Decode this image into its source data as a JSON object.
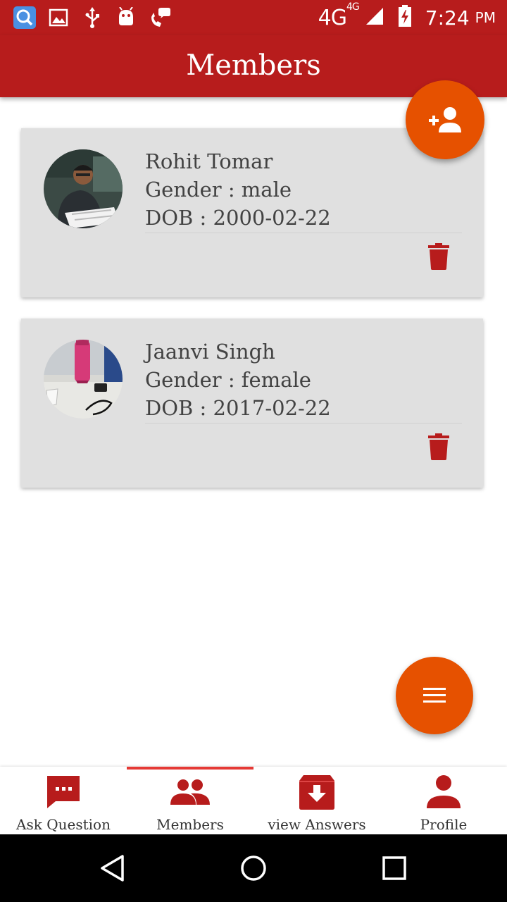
{
  "status_bar": {
    "network": "4G",
    "network_small": "4G",
    "time": "7:24",
    "ampm": "PM",
    "icons": [
      "search-app-icon",
      "gallery-icon",
      "usb-icon",
      "android-icon",
      "call-icon",
      "signal-icon",
      "battery-charging-icon"
    ]
  },
  "app_bar": {
    "title": "Members"
  },
  "members": [
    {
      "name": "Rohit Tomar",
      "gender": "Gender : male",
      "dob": "DOB : 2000-02-22"
    },
    {
      "name": "Jaanvi Singh",
      "gender": "Gender : female",
      "dob": "DOB : 2017-02-22"
    }
  ],
  "fab": {
    "add_icon": "add-person-icon",
    "menu_icon": "menu-icon"
  },
  "bottom_nav": {
    "active_index": 1,
    "items": [
      {
        "label": "Ask Question",
        "icon": "chat-icon"
      },
      {
        "label": "Members",
        "icon": "people-icon"
      },
      {
        "label": "view Answers",
        "icon": "archive-icon"
      },
      {
        "label": "Profile",
        "icon": "person-icon"
      }
    ]
  },
  "colors": {
    "primary": "#b71c1c",
    "accent": "#e65100",
    "card": "#e0e0e0",
    "indicator": "#e53935"
  }
}
